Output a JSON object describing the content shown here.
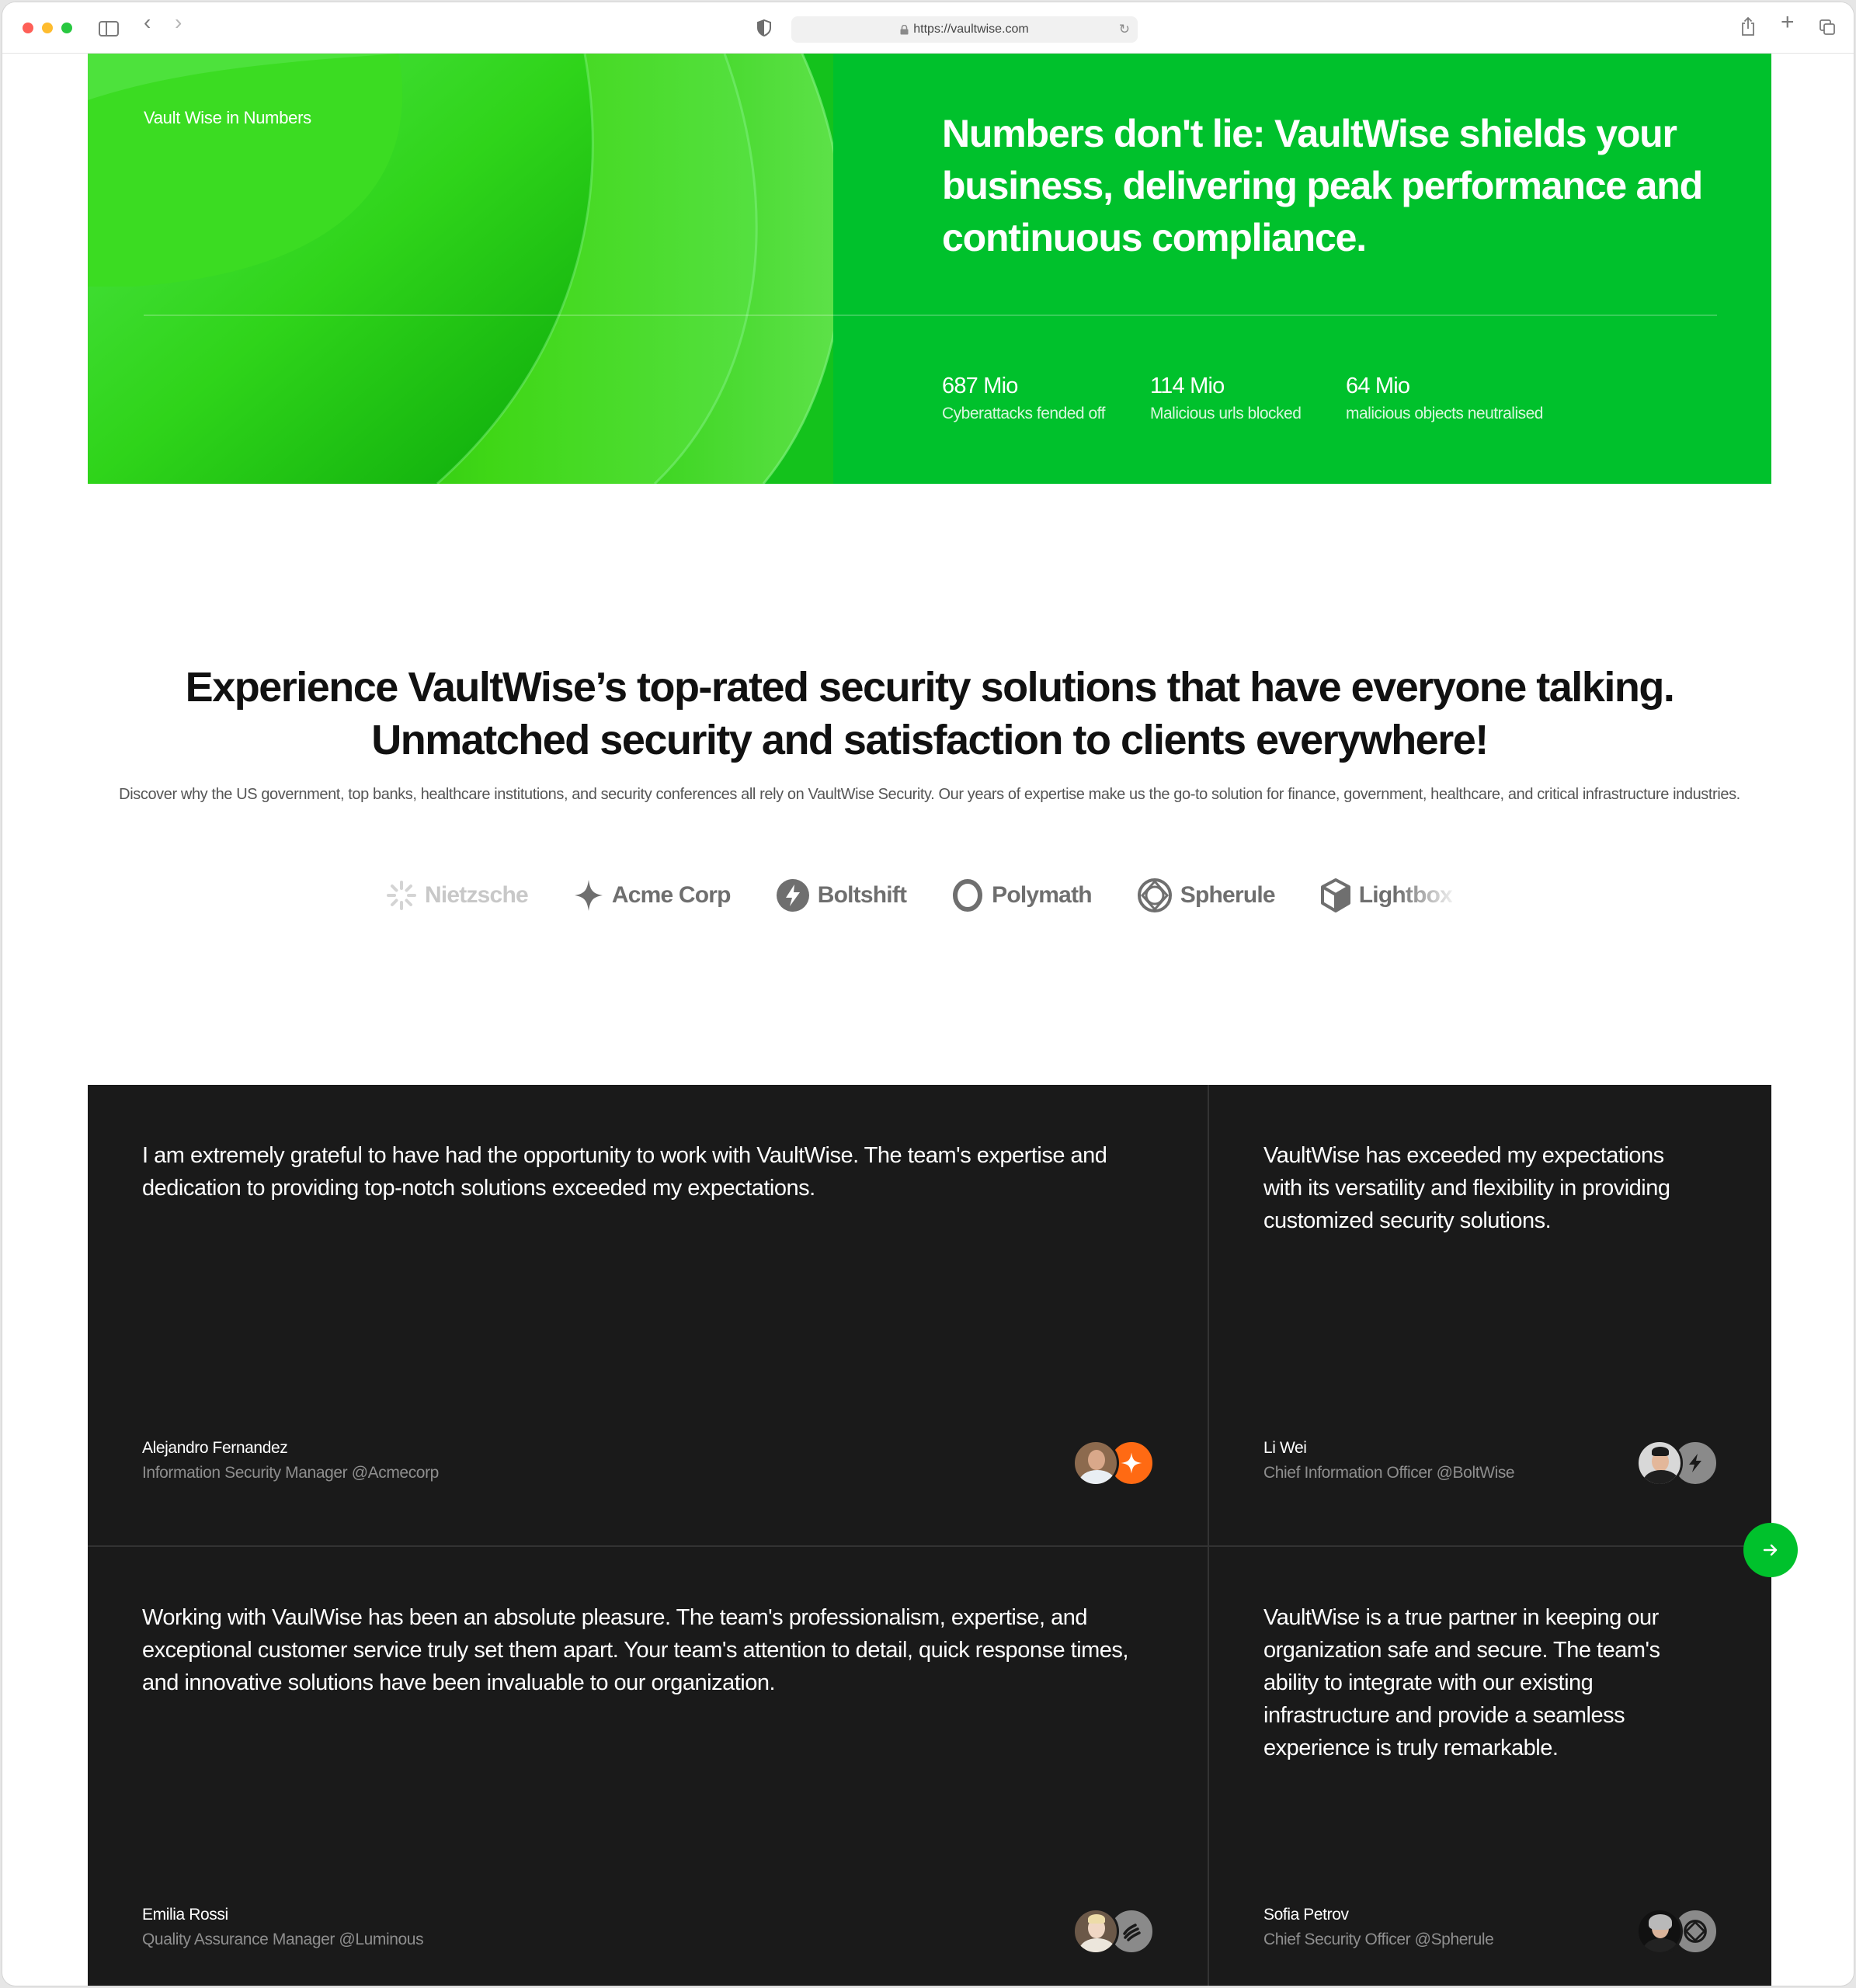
{
  "browser": {
    "url": "https://vaultwise.com",
    "icons": [
      "sidebar-toggle-icon",
      "back-icon",
      "forward-icon",
      "privacy-shield-icon",
      "lock-icon",
      "reload-icon",
      "share-icon",
      "new-tab-icon",
      "tab-overview-icon"
    ]
  },
  "hero": {
    "eyebrow": "Vault Wise in Numbers",
    "headline": "Numbers don't lie: VaultWise shields your business, delivering peak performance and continuous compliance.",
    "accent_color": "#00c12c",
    "stats": [
      {
        "value": "687 Mio",
        "label": "Cyberattacks fended off"
      },
      {
        "value": "114 Mio",
        "label": "Malicious urls blocked"
      },
      {
        "value": "64 Mio",
        "label": "malicious objects neutralised"
      }
    ]
  },
  "social_proof": {
    "title": "Experience VaultWise’s top-rated security solutions that have everyone talking. Unmatched security and satisfaction to clients everywhere!",
    "subtitle": "Discover why the US government, top banks, healthcare institutions, and security conferences all rely on VaultWise Security. Our years of expertise make us the go-to solution for finance, government, healthcare, and critical infrastructure industries.",
    "logos": [
      {
        "name": "Nietzsche",
        "icon": "sunburst-icon"
      },
      {
        "name": "Acme Corp",
        "icon": "sparkle-icon"
      },
      {
        "name": "Boltshift",
        "icon": "bolt-icon"
      },
      {
        "name": "Polymath",
        "icon": "ring-icon"
      },
      {
        "name": "Spherule",
        "icon": "sphere-icon"
      },
      {
        "name": "Lightbox",
        "icon": "cube-icon"
      }
    ]
  },
  "testimonials": [
    {
      "quote": "I am extremely grateful to have had the opportunity to work with VaultWise. The team's expertise and dedication to providing top-notch solutions exceeded my expectations.",
      "name": "Alejandro Fernandez",
      "role": "Information Security Manager @Acmecorp",
      "badge_color": "#ff6a13"
    },
    {
      "quote": "VaultWise has exceeded my expectations with its versatility and flexibility in providing customized security solutions.",
      "name": "Li Wei",
      "role": "Chief Information Officer @BoltWise",
      "badge_color": "#8a8a8a"
    },
    {
      "quote": "Working with VaulWise has been an absolute pleasure. The team's professionalism, expertise, and exceptional customer service truly set them apart. Your team's attention to detail, quick response times, and innovative solutions have been invaluable to our organization.",
      "name": "Emilia Rossi",
      "role": "Quality Assurance Manager @Luminous",
      "badge_color": "#8a8a8a"
    },
    {
      "quote": "VaultWise is a true partner in keeping our organization safe and secure. The team's ability to integrate with our existing infrastructure and provide a seamless experience is truly remarkable.",
      "name": "Sofia Petrov",
      "role": "Chief Security Officer @Spherule",
      "badge_color": "#8a8a8a"
    }
  ],
  "carousel": {
    "next_icon": "arrow-right-icon"
  }
}
